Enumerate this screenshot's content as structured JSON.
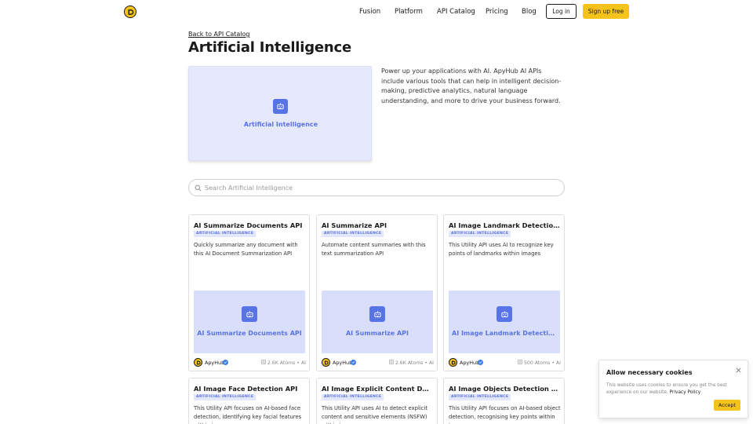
{
  "header": {
    "logo_icon": "apyhub-logo-icon",
    "nav": [
      {
        "label": "Fusion"
      },
      {
        "label": "Platform"
      },
      {
        "label": "API Catalog"
      },
      {
        "label": "Pricing"
      },
      {
        "label": "Blog"
      }
    ],
    "login_label": "Log in",
    "signup_label": "Sign up free"
  },
  "breadcrumb": {
    "back_label": "Back to API Catalog"
  },
  "page": {
    "title": "Artificial Intelligence",
    "hero_label": "Artificial Intelligence",
    "hero_icon": "robot-icon",
    "description": "Power up your applications with AI. ApyHub AI APIs include various tools that can help in intelligent decision-making, predictive analytics, natural language understanding, and more to drive your business forward."
  },
  "search": {
    "placeholder": "Search Artificial Intelligence",
    "value": ""
  },
  "cards": [
    {
      "title": "AI Summarize Documents API",
      "tag": "ARTIFICIAL INTELLIGENCE",
      "description": "Quickly summarize any document with this AI Document Summarization API",
      "image_label": "AI Summarize Documents API",
      "publisher": "ApyHub",
      "stats": "2.6K Atoms • AI"
    },
    {
      "title": "AI Summarize API",
      "tag": "ARTIFICIAL INTELLIGENCE",
      "description": "Automate content summaries with this text summarization API",
      "image_label": "AI Summarize API",
      "publisher": "ApyHub",
      "stats": "2.6K Atoms • AI"
    },
    {
      "title": "AI Image Landmark Detection API",
      "tag": "ARTIFICIAL INTELLIGENCE",
      "description": "This Utility API uses AI to recognize key points of landmarks within images",
      "image_label": "AI Image Landmark Detection...",
      "publisher": "ApyHub",
      "stats": "500 Atoms • AI"
    },
    {
      "title": "AI Image Face Detection API",
      "tag": "ARTIFICIAL INTELLIGENCE",
      "description": "This Utility API focuses on AI-based face detection, identifying key facial features within images",
      "image_label": "",
      "publisher": "",
      "stats": ""
    },
    {
      "title": "AI Image Explicit Content Detection API",
      "tag": "ARTIFICIAL INTELLIGENCE",
      "description": "This Utility API uses AI to detect explicit content and sensitive elements (NSFW) within images",
      "image_label": "",
      "publisher": "",
      "stats": ""
    },
    {
      "title": "AI Image Objects Detection API",
      "tag": "ARTIFICIAL INTELLIGENCE",
      "description": "This Utility API focuses on AI-based object detection, recognising key points within images",
      "image_label": "",
      "publisher": "",
      "stats": ""
    }
  ],
  "cookie": {
    "title": "Allow necessary cookies",
    "text": "This website uses cookies to ensure you get the best experience on our website.",
    "policy_label": "Privacy Policy",
    "accept_label": "Accept"
  },
  "colors": {
    "accent": "#f5c31a",
    "brand_blue": "#5a73e6",
    "tile_bg": "#d9dffb"
  }
}
